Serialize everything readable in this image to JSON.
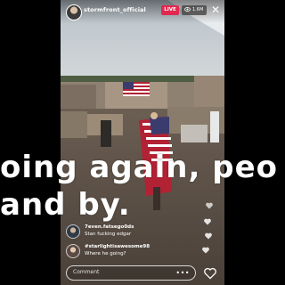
{
  "header": {
    "username": "stormfront_official",
    "live_label": "LIVE",
    "viewer_count": "1.6M",
    "close_icon": "✕"
  },
  "subtitles": {
    "line1": "oing again, peo",
    "line2": "and by."
  },
  "comments": [
    {
      "user": "7even.fatsego0ds",
      "text": "Stan fucking edgar"
    },
    {
      "user": "#starlightisawesome98",
      "text": "Where he going?"
    }
  ],
  "comment_bar": {
    "placeholder": "Comment",
    "more_label": "•••"
  },
  "icons": {
    "close": "close-icon",
    "eye": "eye-icon",
    "heart": "heart-icon"
  },
  "colors": {
    "live": "#e3284f",
    "flag_red": "#b22234",
    "flag_blue": "#3c3b6e"
  }
}
